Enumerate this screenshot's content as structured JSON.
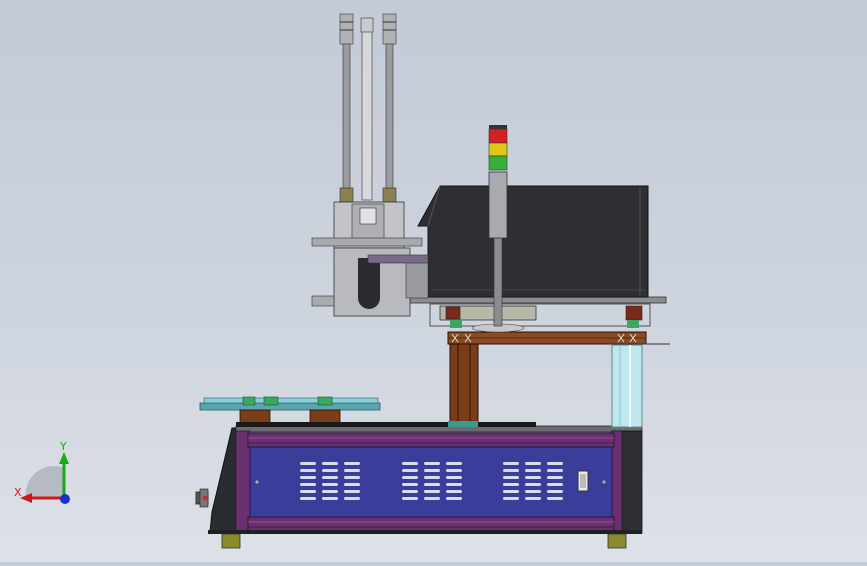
{
  "viewport": {
    "background_top": "#c3cbd8",
    "background_bottom": "#dde1e8"
  },
  "triad": {
    "x_label": "X",
    "y_label": "Y",
    "x_color": "#d01818",
    "y_color": "#18a818",
    "z_color": "#1830d0"
  },
  "model": {
    "cabinet_color": "#3a3d9a",
    "frame_color": "#6a2f70",
    "signal_tower_colors": [
      "#d42020",
      "#e0c818",
      "#38b038"
    ],
    "hood_color": "#2e2f33",
    "column_color": "#7a3d1a",
    "guard_color": "#bfe7ee"
  }
}
